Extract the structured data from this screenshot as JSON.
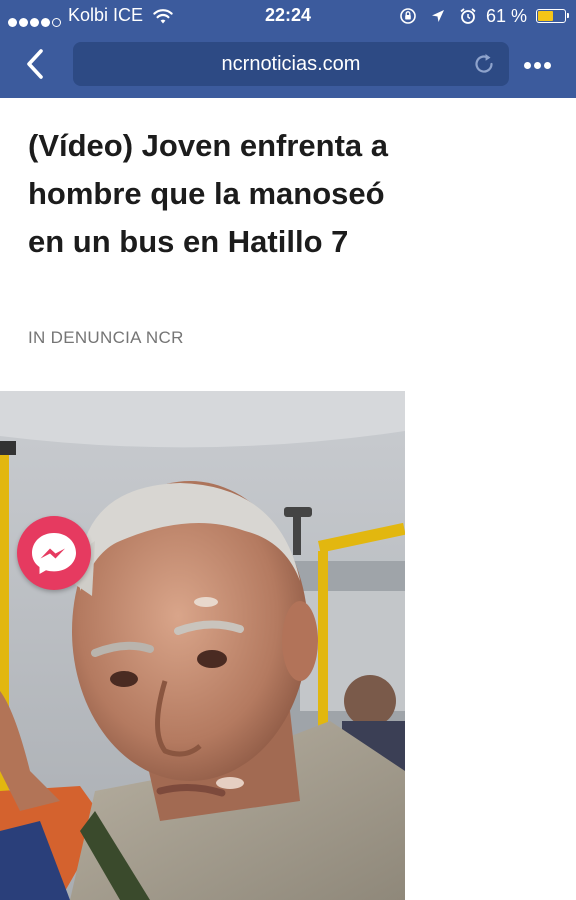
{
  "status_bar": {
    "signal_dots": [
      true,
      true,
      true,
      true,
      false
    ],
    "carrier": "Kolbi ICE",
    "time": "22:24",
    "battery_percent": "61 %",
    "battery_level": 0.61,
    "icons": [
      "wifi-icon",
      "orientation-lock-icon",
      "location-arrow-icon",
      "alarm-clock-icon",
      "battery-icon"
    ]
  },
  "browser": {
    "url": "ncrnoticias.com",
    "icons": [
      "chevron-left-icon",
      "reload-icon",
      "more-dots-icon"
    ]
  },
  "article": {
    "title": "(Vídeo) Joven enfrenta a hombre que la manoseó en un bus en Hatillo 7",
    "category_prefix": "IN",
    "category": "DENUNCIA NCR"
  },
  "media": {
    "icons": [
      "messenger-icon"
    ]
  },
  "colors": {
    "chrome": "#3c5b9d",
    "url_bar": "#2d4a84",
    "messenger": "#e63a60",
    "battery_fill": "#f5c518"
  }
}
